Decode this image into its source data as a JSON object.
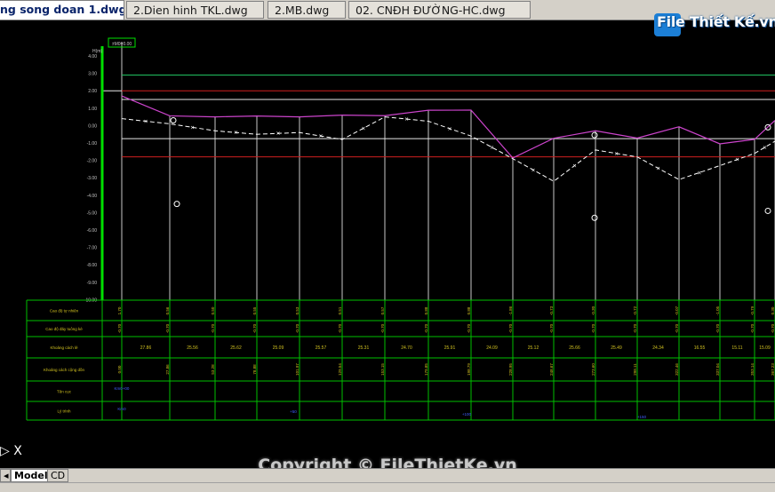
{
  "tabs": [
    {
      "label": "ng song doan 1.dwg",
      "active": true
    },
    {
      "label": "2.Dien hinh TKL.dwg",
      "active": false
    },
    {
      "label": "2.MB.dwg",
      "active": false
    },
    {
      "label": "02. CNĐH ĐƯỜNG-HC.dwg",
      "active": false
    }
  ],
  "watermark": {
    "logo": "File Thiết Kế.vn",
    "copyright": "Copyright © FileThietKe.vn"
  },
  "layout_tabs": [
    {
      "label": "Model",
      "active": true
    },
    {
      "label": "CD",
      "active": false
    }
  ],
  "ucs_icon": "X",
  "colors": {
    "background": "#000000",
    "axis": "#00e000",
    "grid": "#c8c8c8",
    "ground": "#cc44cc",
    "bed": "#ffffff",
    "red_line": "#d02020",
    "table": "#00c000",
    "table_text": "#d0c020",
    "blue_text": "#4060ff"
  },
  "profile": {
    "datum_box": "±M0=0.00",
    "y_title": "H(m)",
    "y_ticks": [
      "4.00",
      "3.00",
      "2.00",
      "1.00",
      "0.00",
      "-1.00",
      "-2.00",
      "-3.00",
      "-4.00",
      "-5.00",
      "-6.00",
      "-7.00",
      "-8.00",
      "-9.00",
      "-10.00"
    ],
    "ref_levels": {
      "green": 2.9,
      "red": 2.0,
      "white_a": 1.5,
      "white_b": -0.75,
      "red_b": -1.8
    },
    "stations": [
      0,
      54,
      105,
      152,
      200,
      248,
      296,
      345,
      393,
      440,
      486,
      533,
      580,
      627,
      673,
      712,
      735
    ],
    "ground": [
      1.7,
      0.56,
      0.5,
      0.55,
      0.5,
      0.6,
      0.57,
      0.88,
      0.89,
      -1.86,
      -0.73,
      -0.3,
      -0.72,
      -0.07,
      -1.05,
      -0.79,
      0.3
    ],
    "bed": [
      0.4,
      0.1,
      -0.3,
      -0.5,
      -0.4,
      -0.8,
      0.5,
      0.25,
      -0.6,
      -1.9,
      -3.2,
      -1.4,
      -1.8,
      -3.1,
      -2.3,
      -1.6,
      -0.9
    ],
    "circle_markers": [
      {
        "s": 62,
        "v": -4.5
      },
      {
        "s": 532,
        "v": -5.3
      },
      {
        "s": 727,
        "v": -4.9
      }
    ]
  },
  "table": {
    "rows": [
      "Cao độ tự nhiên",
      "Cao độ đáy tuông kè",
      "Khoảng cách lẻ",
      "Khoảng cách cộng dồn",
      "Tên cọc",
      "Lý trình"
    ],
    "elev": [
      "1.70",
      "0.56",
      "0.50",
      "0.55",
      "0.53",
      "0.51",
      "0.57",
      "0.88",
      "0.88",
      "-1.86",
      "-0.73",
      "-0.30",
      "-0.72",
      "-0.07",
      "-1.05",
      "-0.79",
      "0.30"
    ],
    "bed_elev": [
      "-0.70",
      "-0.70",
      "-0.70",
      "-0.70",
      "-0.70",
      "-0.70",
      "-0.70",
      "-0.70",
      "-0.70",
      "-0.70",
      "-0.70",
      "-0.70",
      "-0.70",
      "-0.70",
      "-0.70",
      "-0.70",
      "-0.70"
    ],
    "dist": [
      "27.86",
      "25.56",
      "25.62",
      "25.09",
      "25.57",
      "25.31",
      "24.70",
      "25.91",
      "24.09",
      "25.12",
      "25.66",
      "25.49",
      "24.34",
      "16.55",
      "15.11",
      "15.09",
      "16.03"
    ],
    "cum": [
      "0.00",
      "27.86",
      "53.28",
      "78.88",
      "101.97",
      "129.54",
      "153.15",
      "179.85",
      "198.79",
      "228.95",
      "248.67",
      "273.60",
      "298.11",
      "322.46",
      "337.04",
      "353.14",
      "367.23"
    ],
    "name_first": "Km0+00",
    "chain": [
      "Km0",
      "+50",
      "+100",
      "+150"
    ]
  }
}
